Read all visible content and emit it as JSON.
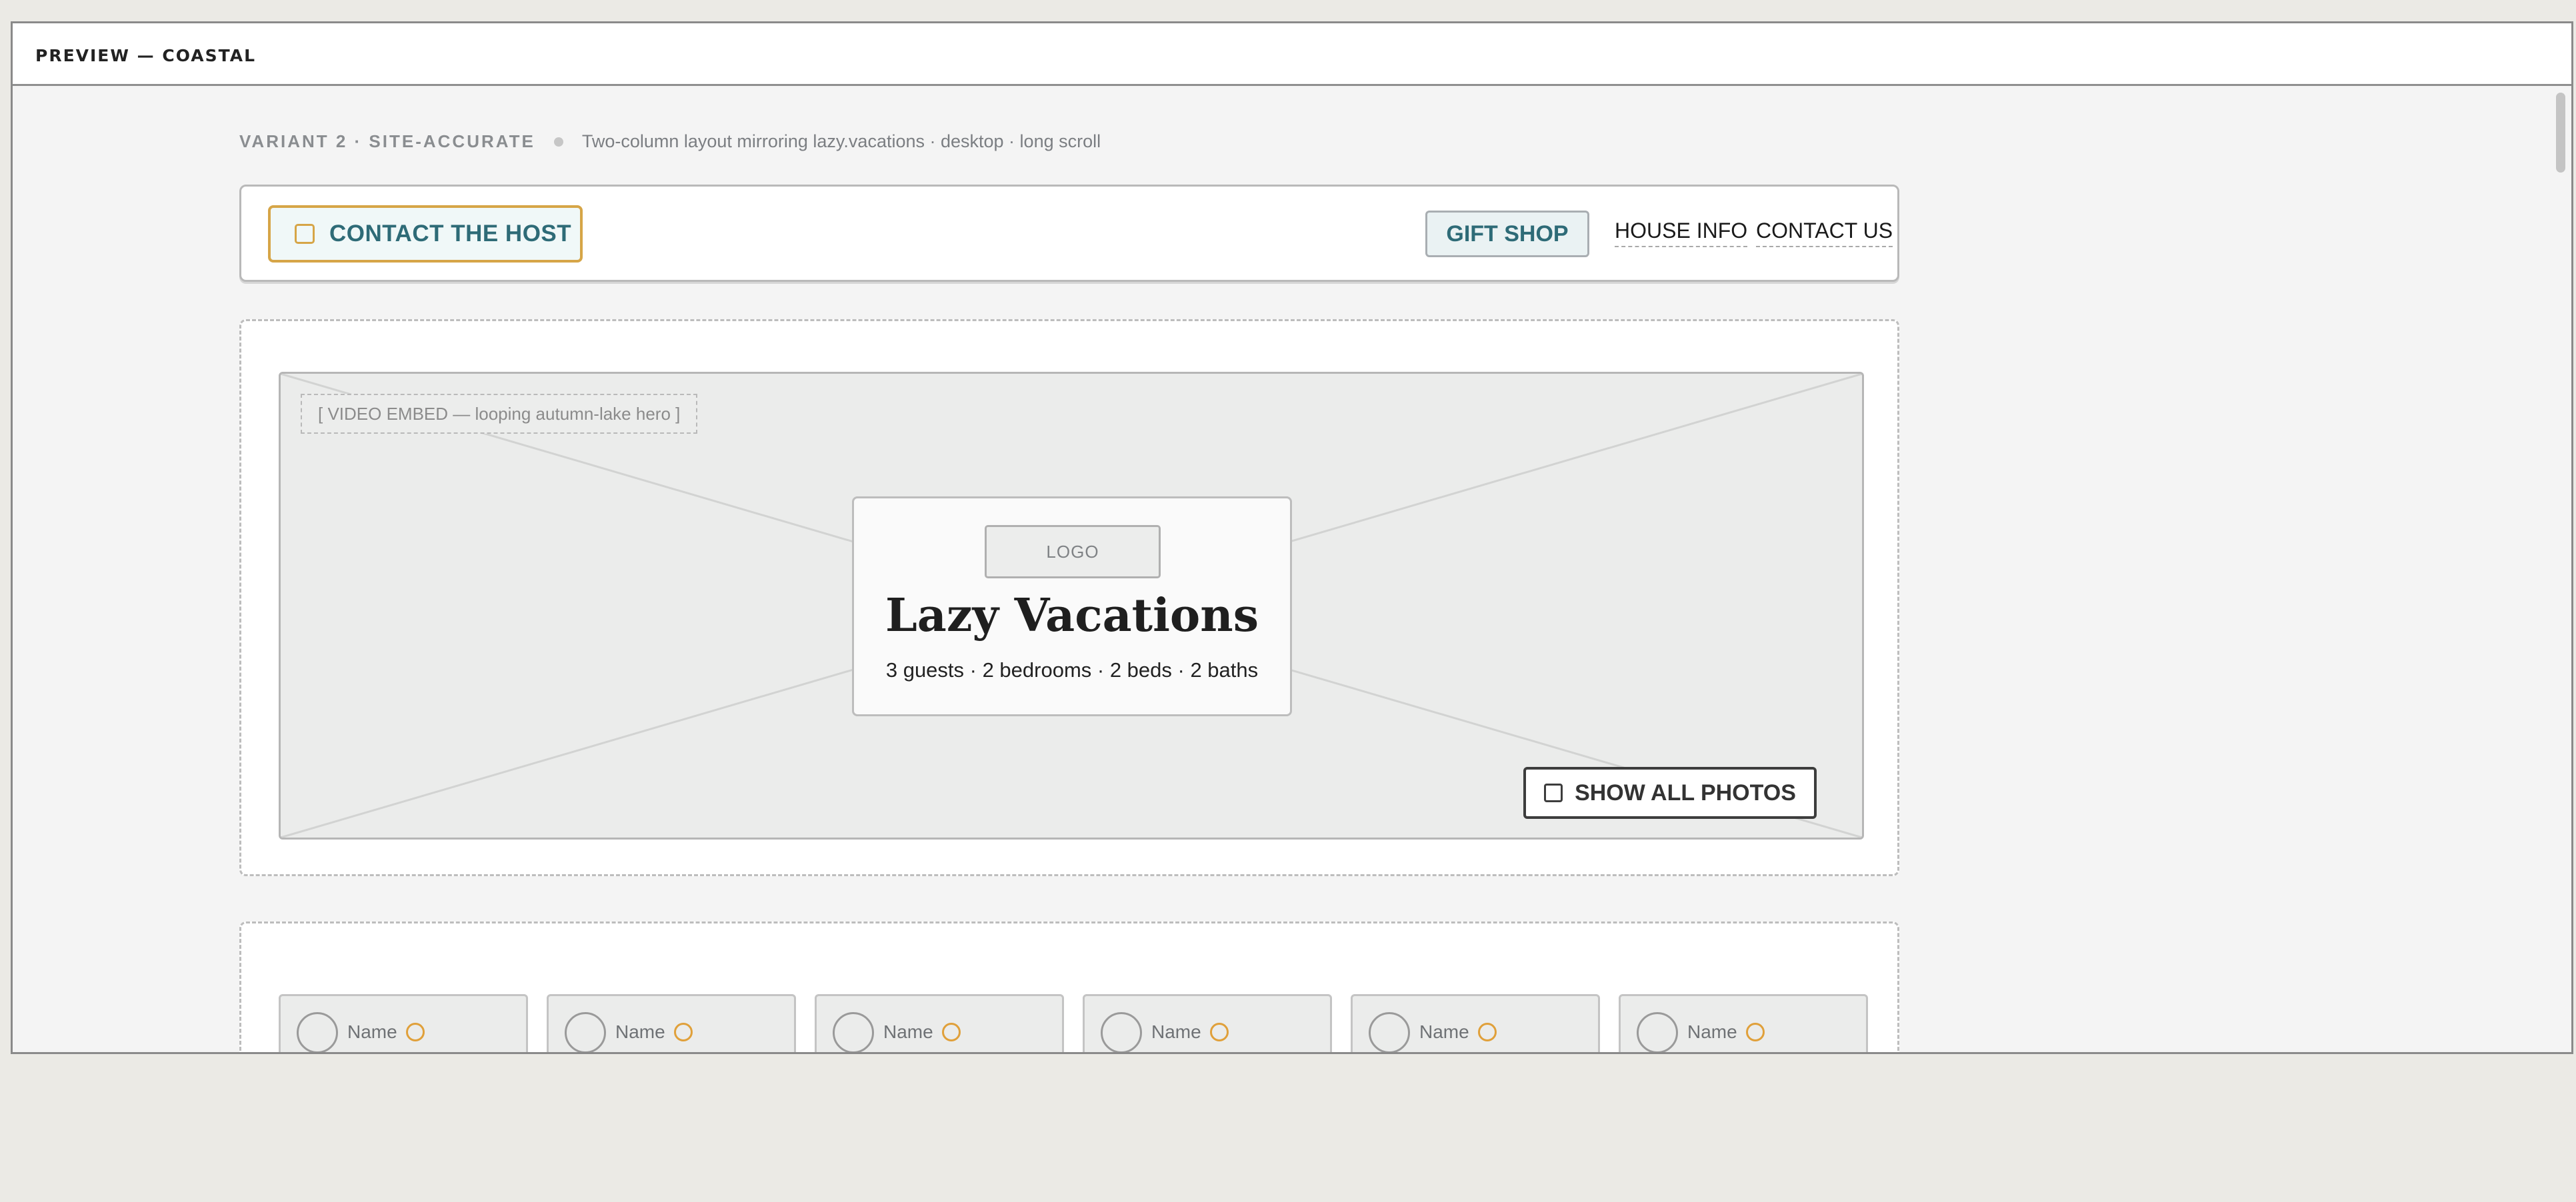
{
  "window": {
    "title": "PREVIEW — COASTAL"
  },
  "meta": {
    "variant_label": "VARIANT 2 · SITE-ACCURATE",
    "description": "Two-column layout mirroring lazy.vacations · desktop · long scroll"
  },
  "nav": {
    "contact_host": "CONTACT THE HOST",
    "gift_shop": "GIFT SHOP",
    "house_info": "HOUSE INFO",
    "contact_us": "CONTACT US"
  },
  "hero": {
    "video_label": "[ VIDEO EMBED — looping autumn-lake hero ]",
    "logo": "LOGO",
    "title": "Lazy Vacations",
    "subtitle": "3 guests · 2 bedrooms · 2 beds · 2 baths",
    "show_photos": "SHOW ALL PHOTOS"
  },
  "reviews": [
    {
      "name": "Name",
      "stars": "★★★★★"
    },
    {
      "name": "Name",
      "stars": "★★★★★"
    },
    {
      "name": "Name",
      "stars": "★★★★★"
    },
    {
      "name": "Name",
      "stars": "★★★★☆"
    },
    {
      "name": "Name",
      "stars": "★★★★★"
    },
    {
      "name": "Name",
      "stars": "★★★★★"
    }
  ],
  "colors": {
    "accent_gold": "#d6a547",
    "accent_teal": "#2e6b77",
    "page_bg": "#ebeae5"
  },
  "icons": {
    "contact_host": "checkbox-icon",
    "show_photos": "checkbox-icon",
    "review_avatar": "avatar-circle-icon",
    "review_badge": "badge-circle-icon"
  }
}
